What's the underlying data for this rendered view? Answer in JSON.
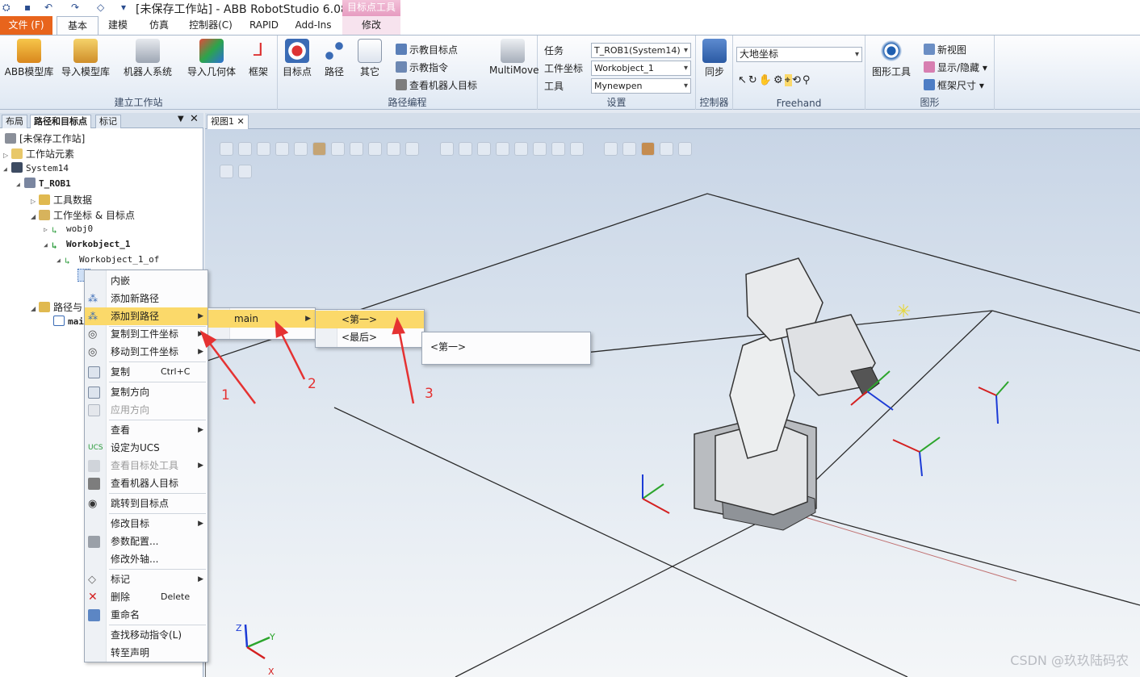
{
  "titlebar": {
    "title": "[未保存工作站] - ABB RobotStudio 6.08",
    "context_tab_title": "目标点工具"
  },
  "tabs": [
    {
      "label": "文件 (F)"
    },
    {
      "label": "基本"
    },
    {
      "label": "建模"
    },
    {
      "label": "仿真"
    },
    {
      "label": "控制器(C)"
    },
    {
      "label": "RAPID"
    },
    {
      "label": "Add-Ins"
    },
    {
      "label": "修改"
    }
  ],
  "ribbon": {
    "build_station": {
      "label": "建立工作站",
      "abb_library": "ABB模型库",
      "import_library": "导入模型库",
      "robot_system": "机器人系统",
      "import_geometry": "导入几何体",
      "frame": "框架"
    },
    "path_programming": {
      "label": "路径编程",
      "target": "目标点",
      "path": "路径",
      "other": "其它",
      "teach_target": "示教目标点",
      "teach_instruction": "示教指令",
      "view_robot_target": "查看机器人目标",
      "multimove": "MultiMove"
    },
    "settings": {
      "label": "设置",
      "task_label": "任务",
      "task_value": "T_ROB1(System14)",
      "wobj_label": "工件坐标",
      "wobj_value": "Workobject_1",
      "tool_label": "工具",
      "tool_value": "Mynewpen"
    },
    "controller": {
      "label": "控制器",
      "sync": "同步"
    },
    "freehand": {
      "label": "Freehand",
      "coordinate_value": "大地坐标"
    },
    "graphics": {
      "label": "图形",
      "graphics_tools": "图形工具",
      "new_view": "新视图",
      "show_hide": "显示/隐藏",
      "frame_size": "框架尺寸"
    }
  },
  "left_panel": {
    "tabs": [
      "布局",
      "路径和目标点",
      "标记"
    ],
    "tree": {
      "station": "[未保存工作站]",
      "station_elements": "工作站元素",
      "system": "System14",
      "task": "T_ROB1",
      "tooldata": "工具数据",
      "wobj_targets": "工作坐标 & 目标点",
      "wobj0": "wobj0",
      "workobject_1": "Workobject_1",
      "workobject_1_of": "Workobject_1_of",
      "paths_procedures": "路径与",
      "main": "mai"
    }
  },
  "viewport": {
    "tab_label": "视图1"
  },
  "context_menu": {
    "items": [
      {
        "label": "内嵌"
      },
      {
        "label": "添加新路径"
      },
      {
        "label": "添加到路径"
      },
      {
        "label": "复制到工件坐标"
      },
      {
        "label": "移动到工件坐标"
      },
      {
        "label": "复制",
        "shortcut": "Ctrl+C"
      },
      {
        "label": "复制方向"
      },
      {
        "label": "应用方向"
      },
      {
        "label": "查看"
      },
      {
        "label": "设定为UCS"
      },
      {
        "label": "查看目标处工具"
      },
      {
        "label": "查看机器人目标"
      },
      {
        "label": "跳转到目标点"
      },
      {
        "label": "修改目标"
      },
      {
        "label": "参数配置..."
      },
      {
        "label": "修改外轴..."
      },
      {
        "label": "标记"
      },
      {
        "label": "删除",
        "shortcut": "Delete"
      },
      {
        "label": "重命名"
      },
      {
        "label": "查找移动指令(L)"
      },
      {
        "label": "转至声明"
      }
    ]
  },
  "submenu_path": {
    "item": "main"
  },
  "submenu_position": {
    "first": "<第一>",
    "last": "<最后>"
  },
  "tooltip": {
    "text": "<第一>"
  },
  "annotations": {
    "one": "1",
    "two": "2",
    "three": "3"
  },
  "axes": {
    "x": "X",
    "y": "Y",
    "z": "Z"
  },
  "watermark": "CSDN @玖玖陆码农",
  "colors": {
    "accent_file": "#e8641c",
    "highlight": "#fbd96a",
    "annotation": "#e53232"
  }
}
